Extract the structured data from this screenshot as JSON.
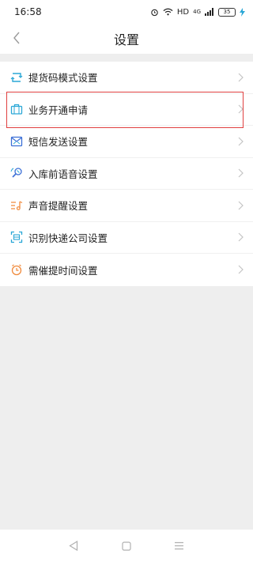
{
  "status_bar": {
    "time": "16:58",
    "network": "HD",
    "signal": "4G",
    "battery": "35"
  },
  "header": {
    "title": "设置"
  },
  "settings": [
    {
      "label": "提货码模式设置",
      "icon": "swap-icon",
      "color": "#2aa7d6"
    },
    {
      "label": "业务开通申请",
      "icon": "briefcase-icon",
      "color": "#2aa7d6"
    },
    {
      "label": "短信发送设置",
      "icon": "sms-icon",
      "color": "#3b6fd6"
    },
    {
      "label": "入库前语音设置",
      "icon": "voice-icon",
      "color": "#3b6fd6"
    },
    {
      "label": "声音提醒设置",
      "icon": "sound-icon",
      "color": "#f08a3c"
    },
    {
      "label": "识别快递公司设置",
      "icon": "scan-icon",
      "color": "#2aa7d6"
    },
    {
      "label": "需催提时间设置",
      "icon": "clock-icon",
      "color": "#f08a3c"
    }
  ],
  "highlight_color": "#e04040"
}
